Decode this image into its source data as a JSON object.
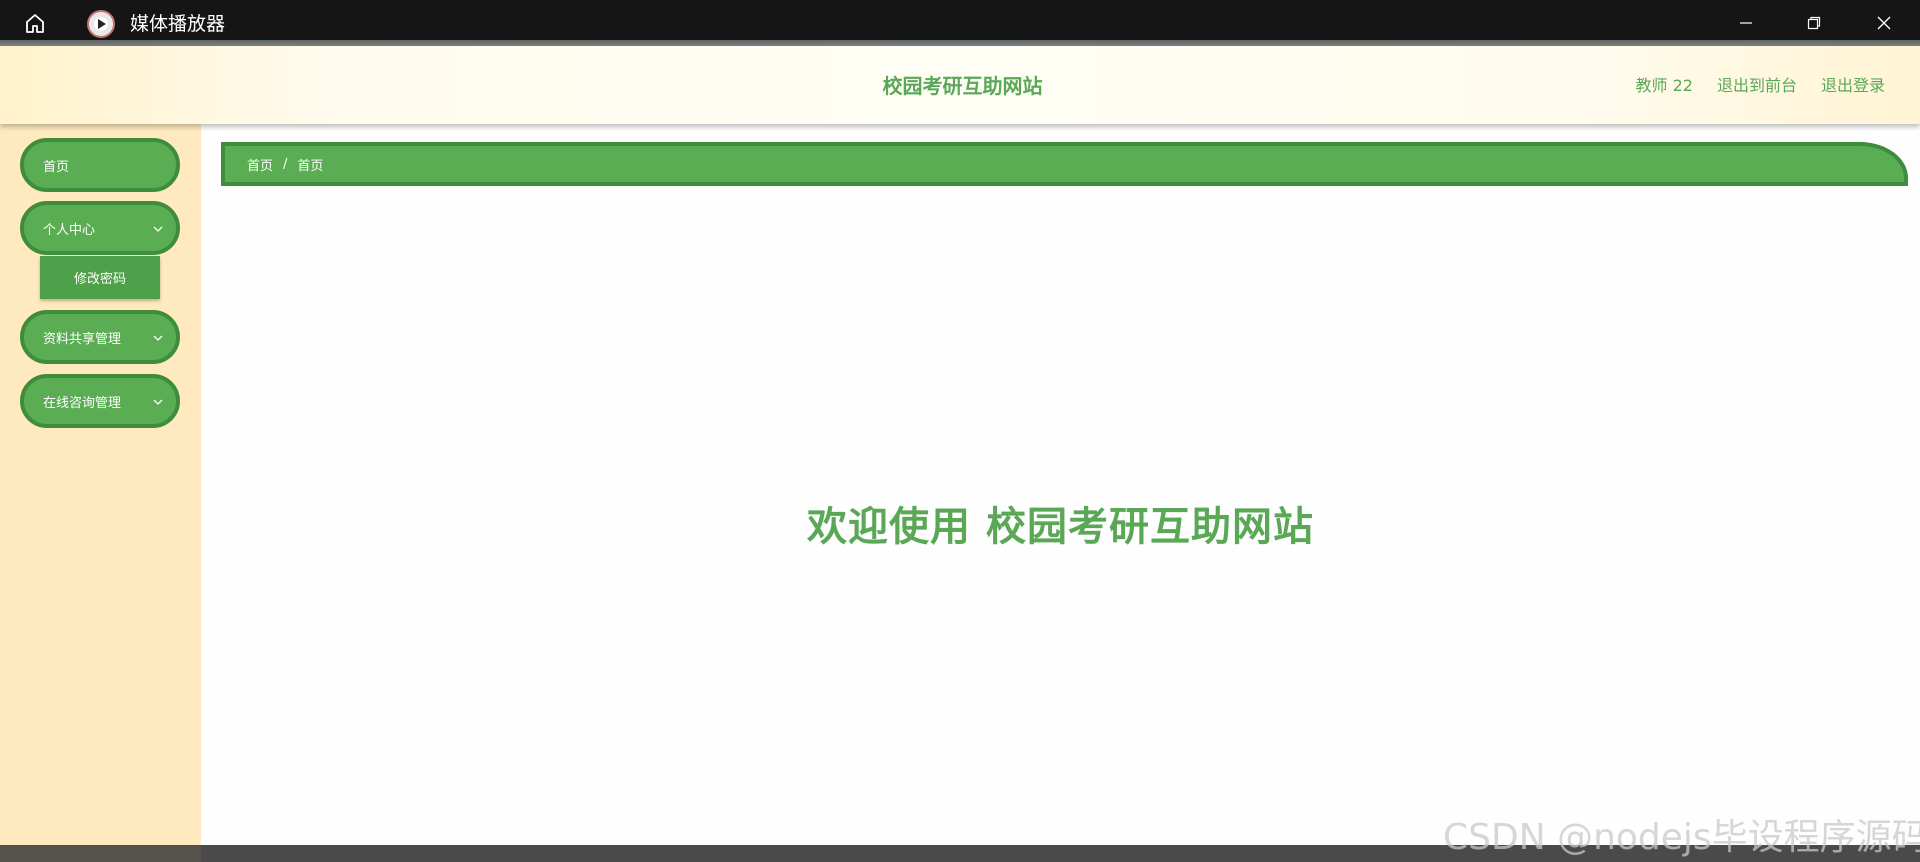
{
  "window": {
    "app_title": "媒体播放器",
    "icons": [
      "home-icon",
      "media-player-icon",
      "minimize-icon",
      "maximize-icon",
      "close-icon"
    ]
  },
  "header": {
    "site_title": "校园考研互助网站",
    "user_label": "教师 22",
    "back_to_front_label": "退出到前台",
    "logout_label": "退出登录"
  },
  "sidebar": {
    "items": [
      {
        "label": "首页",
        "expandable": false
      },
      {
        "label": "个人中心",
        "expandable": true,
        "submenu": [
          {
            "label": "修改密码"
          }
        ]
      },
      {
        "label": "资料共享管理",
        "expandable": true
      },
      {
        "label": "在线咨询管理",
        "expandable": true
      }
    ]
  },
  "breadcrumb": {
    "root": "首页",
    "separator": "/",
    "current": "首页"
  },
  "main": {
    "welcome_text": "欢迎使用 校园考研互助网站"
  },
  "watermark": "CSDN @nodejs毕设程序源码",
  "colors": {
    "accent_green": "#5aad53",
    "accent_green_dark": "#3f8c3d",
    "title_green": "#5aa856",
    "sidebar_bg": "#ffe9bf",
    "titlebar_bg": "#151515"
  }
}
